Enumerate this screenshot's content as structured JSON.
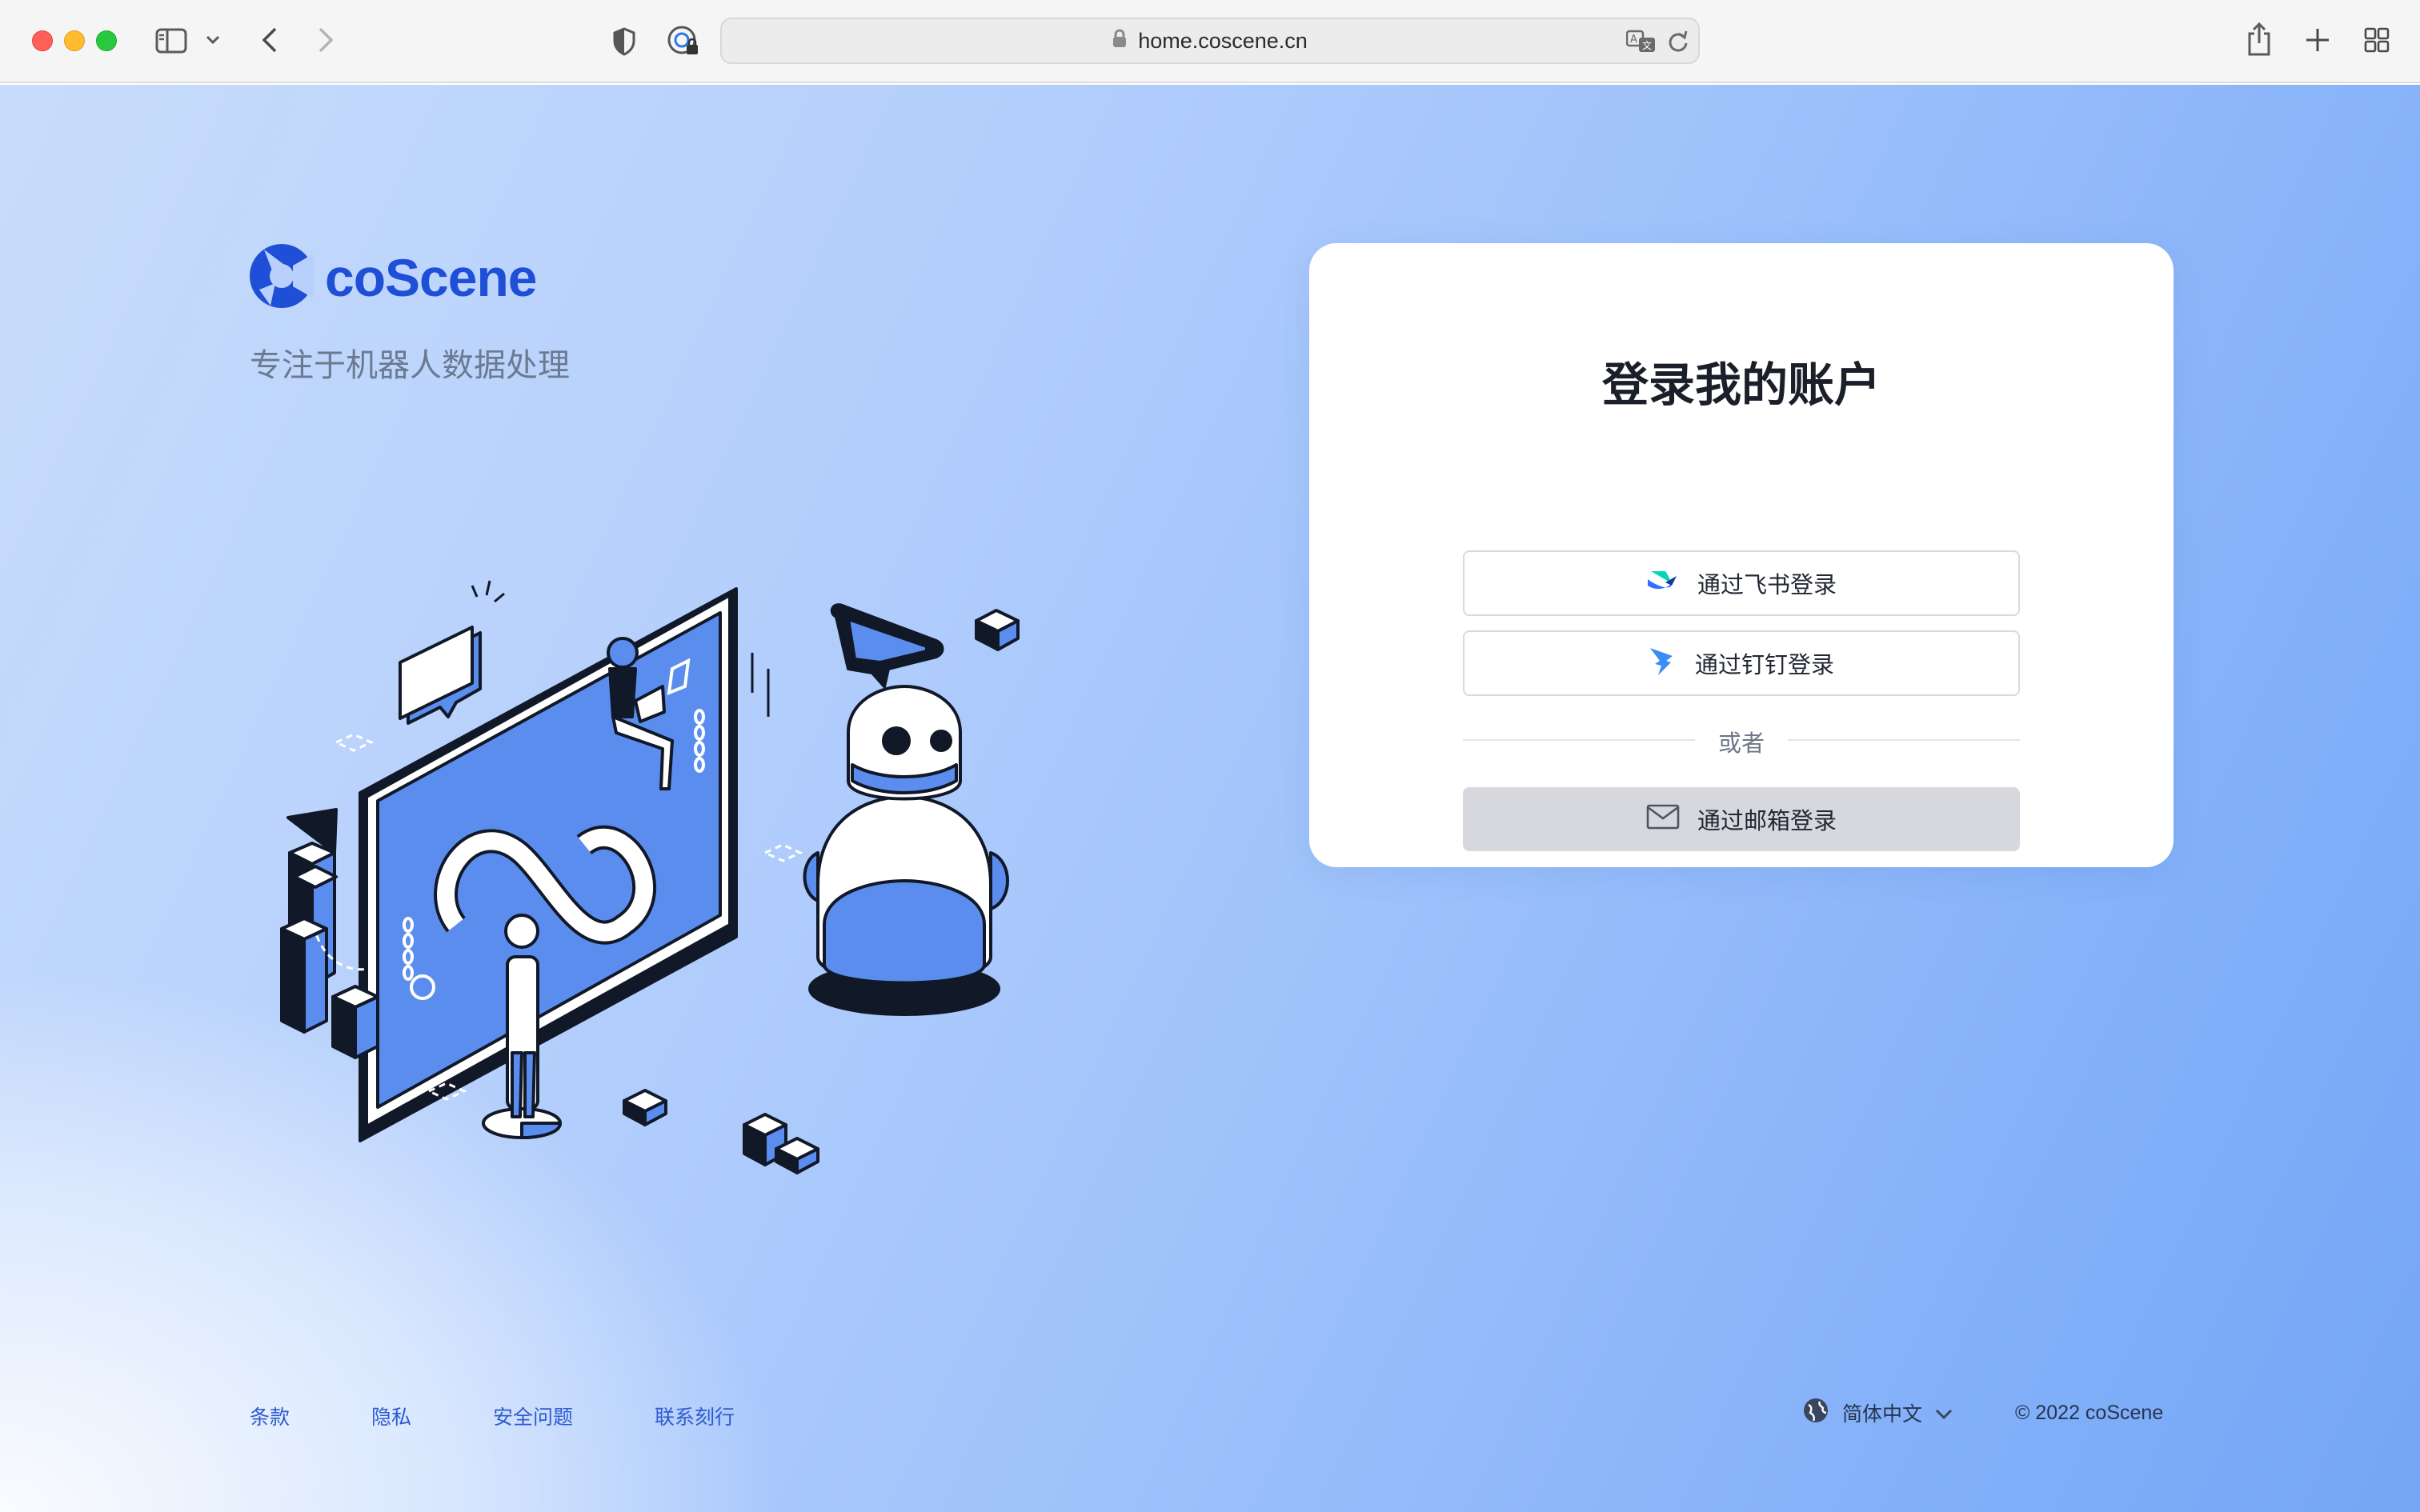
{
  "browser": {
    "url": "home.coscene.cn",
    "icons": [
      "sidebar-icon",
      "chevron-down-icon",
      "back-icon",
      "forward-icon",
      "shield-icon",
      "password-icon",
      "lock-icon",
      "translate-icon",
      "reload-icon",
      "share-icon",
      "plus-icon",
      "tabs-grid-icon"
    ]
  },
  "brand": {
    "name": "coScene",
    "slogan": "专注于机器人数据处理",
    "color": "#1f4fd6"
  },
  "login": {
    "title": "登录我的账户",
    "feishu_label": "通过飞书登录",
    "dingtalk_label": "通过钉钉登录",
    "divider_text": "或者",
    "email_label": "通过邮箱登录"
  },
  "footer": {
    "links": [
      "条款",
      "隐私",
      "安全问题",
      "联系刻行"
    ],
    "language": "简体中文",
    "copyright": "© 2022 coScene"
  }
}
